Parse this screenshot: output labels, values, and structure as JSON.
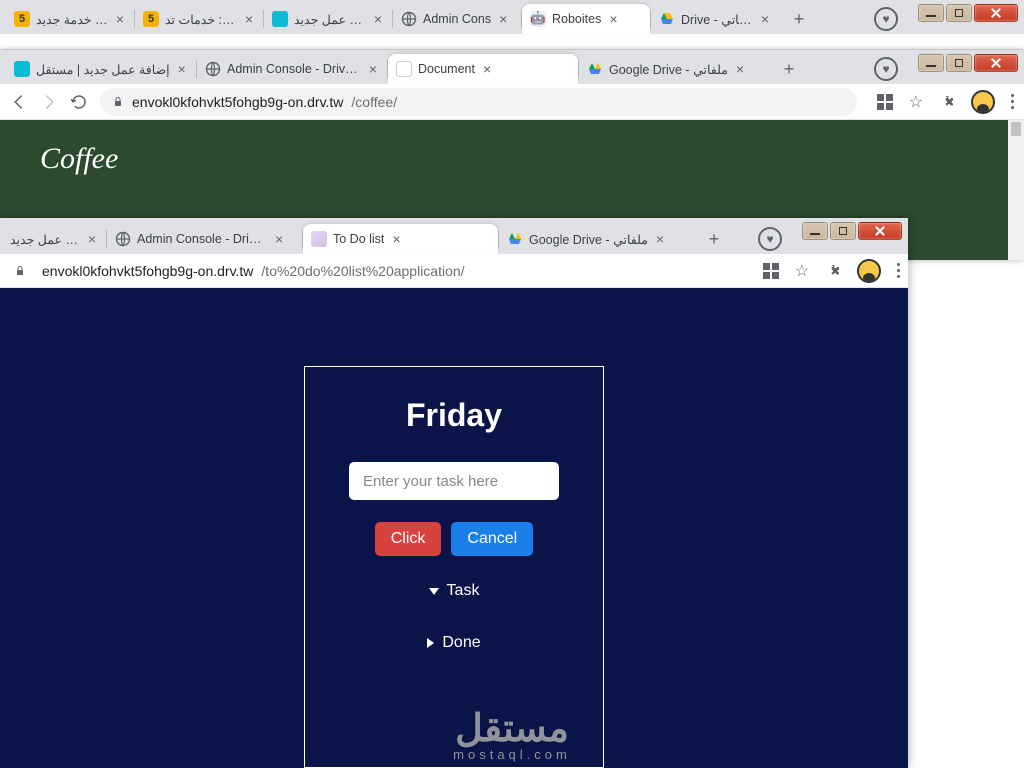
{
  "win1": {
    "tabs": [
      {
        "label": "أضف خدمة جديد"
      },
      {
        "label": "تعديل: خدمات تد"
      },
      {
        "label": "إضافة عمل جديد"
      },
      {
        "label": "Admin Cons"
      },
      {
        "label": "Roboites"
      },
      {
        "label": "Drive - ملفاتي"
      }
    ]
  },
  "win2": {
    "tabs": [
      {
        "label": "إضافة عمل جديد | مستقل"
      },
      {
        "label": "Admin Console - DriveTo"
      },
      {
        "label": "Document"
      },
      {
        "label": "Google Drive - ملفاتي"
      }
    ],
    "url_host": "envokl0kfohvkt5fohgb9g-on.drv.tw",
    "url_path": "/coffee/",
    "page_title": "Coffee"
  },
  "win3": {
    "tabs": [
      {
        "label": "إضافة عمل جديد"
      },
      {
        "label": "Admin Console - DriveTo"
      },
      {
        "label": "To Do list"
      },
      {
        "label": "Google Drive - ملفاتي"
      }
    ],
    "url_host": "envokl0kfohvkt5fohgb9g-on.drv.tw",
    "url_path": "/to%20do%20list%20application/",
    "app": {
      "day": "Friday",
      "placeholder": "Enter your task here",
      "btn_click": "Click",
      "btn_cancel": "Cancel",
      "section_task": "Task",
      "section_done": "Done"
    }
  },
  "watermark": {
    "big": "مستقل",
    "small": "mostaql.com"
  }
}
